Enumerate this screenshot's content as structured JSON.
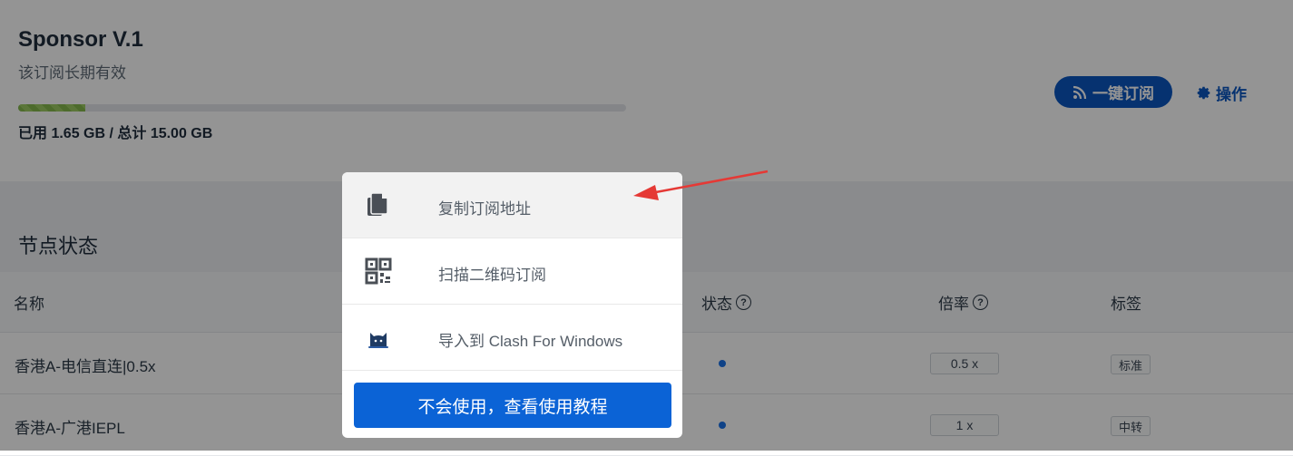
{
  "plan": {
    "name": "Sponsor V.1",
    "validity": "该订阅长期有效",
    "usage_text": "已用 1.65 GB / 总计 15.00 GB",
    "used_fraction": 0.11
  },
  "actions": {
    "subscribe_label": "一键订阅",
    "operate_label": "操作"
  },
  "nodes": {
    "title": "节点状态",
    "columns": {
      "name": "名称",
      "status": "状态",
      "rate": "倍率",
      "tag": "标签"
    },
    "rows": [
      {
        "name": "香港A-电信直连|0.5x",
        "rate": "0.5 x",
        "tag": "标准"
      },
      {
        "name": "香港A-广港IEPL",
        "rate": "1 x",
        "tag": "中转"
      }
    ]
  },
  "modal": {
    "items": [
      {
        "label": "复制订阅地址",
        "icon": "copy-icon"
      },
      {
        "label": "扫描二维码订阅",
        "icon": "qrcode-icon"
      },
      {
        "label": "导入到 Clash For Windows",
        "icon": "clash-cat-icon"
      }
    ],
    "help_button": "不会使用，查看使用教程"
  },
  "colors": {
    "primary": "#0b57c2",
    "progress": "#86b94d",
    "status_dot": "#1a73e8",
    "arrow": "#e53935"
  }
}
